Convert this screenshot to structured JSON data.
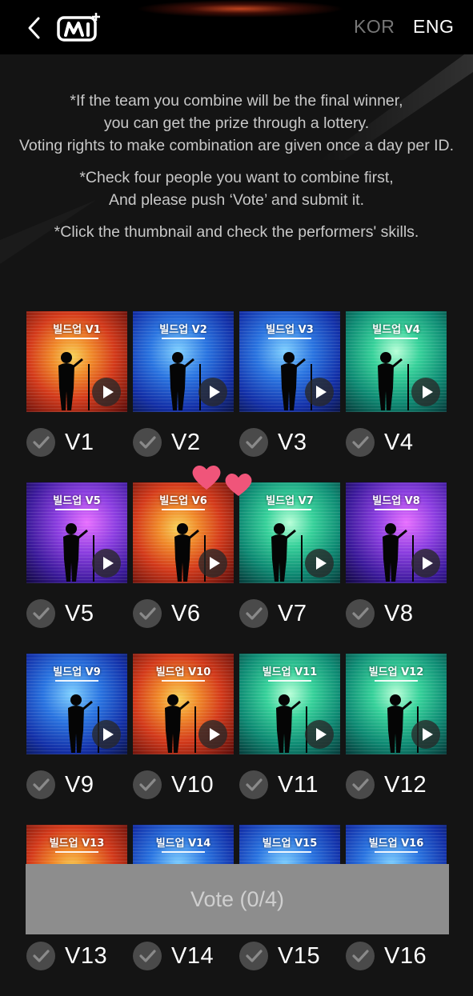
{
  "header": {
    "language_options": [
      "KOR",
      "ENG"
    ],
    "active_language": "ENG"
  },
  "notices": [
    [
      "*If the team you combine will be the final winner,",
      "you can get the prize through a lottery.",
      "Voting rights to make combination are given once a day per ID."
    ],
    [
      "*Check four people you want to combine first,",
      "And please push ‘Vote’ and submit it."
    ],
    [
      "*Click the thumbnail and check the performers' skills."
    ]
  ],
  "performers": [
    {
      "label": "V1",
      "thumb_title": "빌드업 V1",
      "bg": "fire",
      "checked": false
    },
    {
      "label": "V2",
      "thumb_title": "빌드업 V2",
      "bg": "blue",
      "checked": false
    },
    {
      "label": "V3",
      "thumb_title": "빌드업 V3",
      "bg": "blue",
      "checked": false
    },
    {
      "label": "V4",
      "thumb_title": "빌드업 V4",
      "bg": "green",
      "checked": false
    },
    {
      "label": "V5",
      "thumb_title": "빌드업 V5",
      "bg": "purple",
      "checked": false
    },
    {
      "label": "V6",
      "thumb_title": "빌드업 V6",
      "bg": "fire",
      "checked": false
    },
    {
      "label": "V7",
      "thumb_title": "빌드업 V7",
      "bg": "green",
      "checked": false
    },
    {
      "label": "V8",
      "thumb_title": "빌드업 V8",
      "bg": "purple",
      "checked": false
    },
    {
      "label": "V9",
      "thumb_title": "빌드업 V9",
      "bg": "blue",
      "checked": false
    },
    {
      "label": "V10",
      "thumb_title": "빌드업 V10",
      "bg": "fire",
      "checked": false
    },
    {
      "label": "V11",
      "thumb_title": "빌드업 V11",
      "bg": "green",
      "checked": false
    },
    {
      "label": "V12",
      "thumb_title": "빌드업 V12",
      "bg": "green",
      "checked": false
    },
    {
      "label": "V13",
      "thumb_title": "빌드업 V13",
      "bg": "fire",
      "checked": false
    },
    {
      "label": "V14",
      "thumb_title": "빌드업 V14",
      "bg": "blue",
      "checked": false
    },
    {
      "label": "V15",
      "thumb_title": "빌드업 V15",
      "bg": "blue",
      "checked": false
    },
    {
      "label": "V16",
      "thumb_title": "빌드업 V16",
      "bg": "blue",
      "checked": false
    }
  ],
  "vote_button": {
    "label": "Vote (0/4)"
  },
  "colors": {
    "background": "#141414",
    "header": "#000000",
    "notice_text": "#c8c8c8",
    "check_circle": "#4a4a4a",
    "vote_button": "#8d8d8d",
    "heart": "#f0557a"
  }
}
